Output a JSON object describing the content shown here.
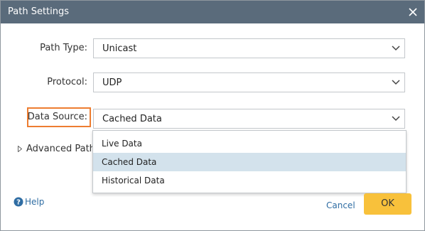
{
  "dialog": {
    "title": "Path Settings",
    "close_icon": "close-icon"
  },
  "fields": {
    "path_type": {
      "label": "Path Type:",
      "value": "Unicast"
    },
    "protocol": {
      "label": "Protocol:",
      "value": "UDP"
    },
    "data_source": {
      "label": "Data Source:",
      "value": "Cached Data"
    }
  },
  "dropdown": {
    "options": [
      "Live Data",
      "Cached Data",
      "Historical Data"
    ],
    "selected": "Cached Data"
  },
  "advanced": {
    "label": "Advanced Path D"
  },
  "footer": {
    "help_label": "Help",
    "cancel_label": "Cancel",
    "ok_label": "OK"
  },
  "colors": {
    "titlebar": "#5a6b7b",
    "highlight_border": "#ed7d31",
    "ok_button": "#f8c13b",
    "link": "#2f6da3",
    "selected_option": "#d3e2ec"
  }
}
